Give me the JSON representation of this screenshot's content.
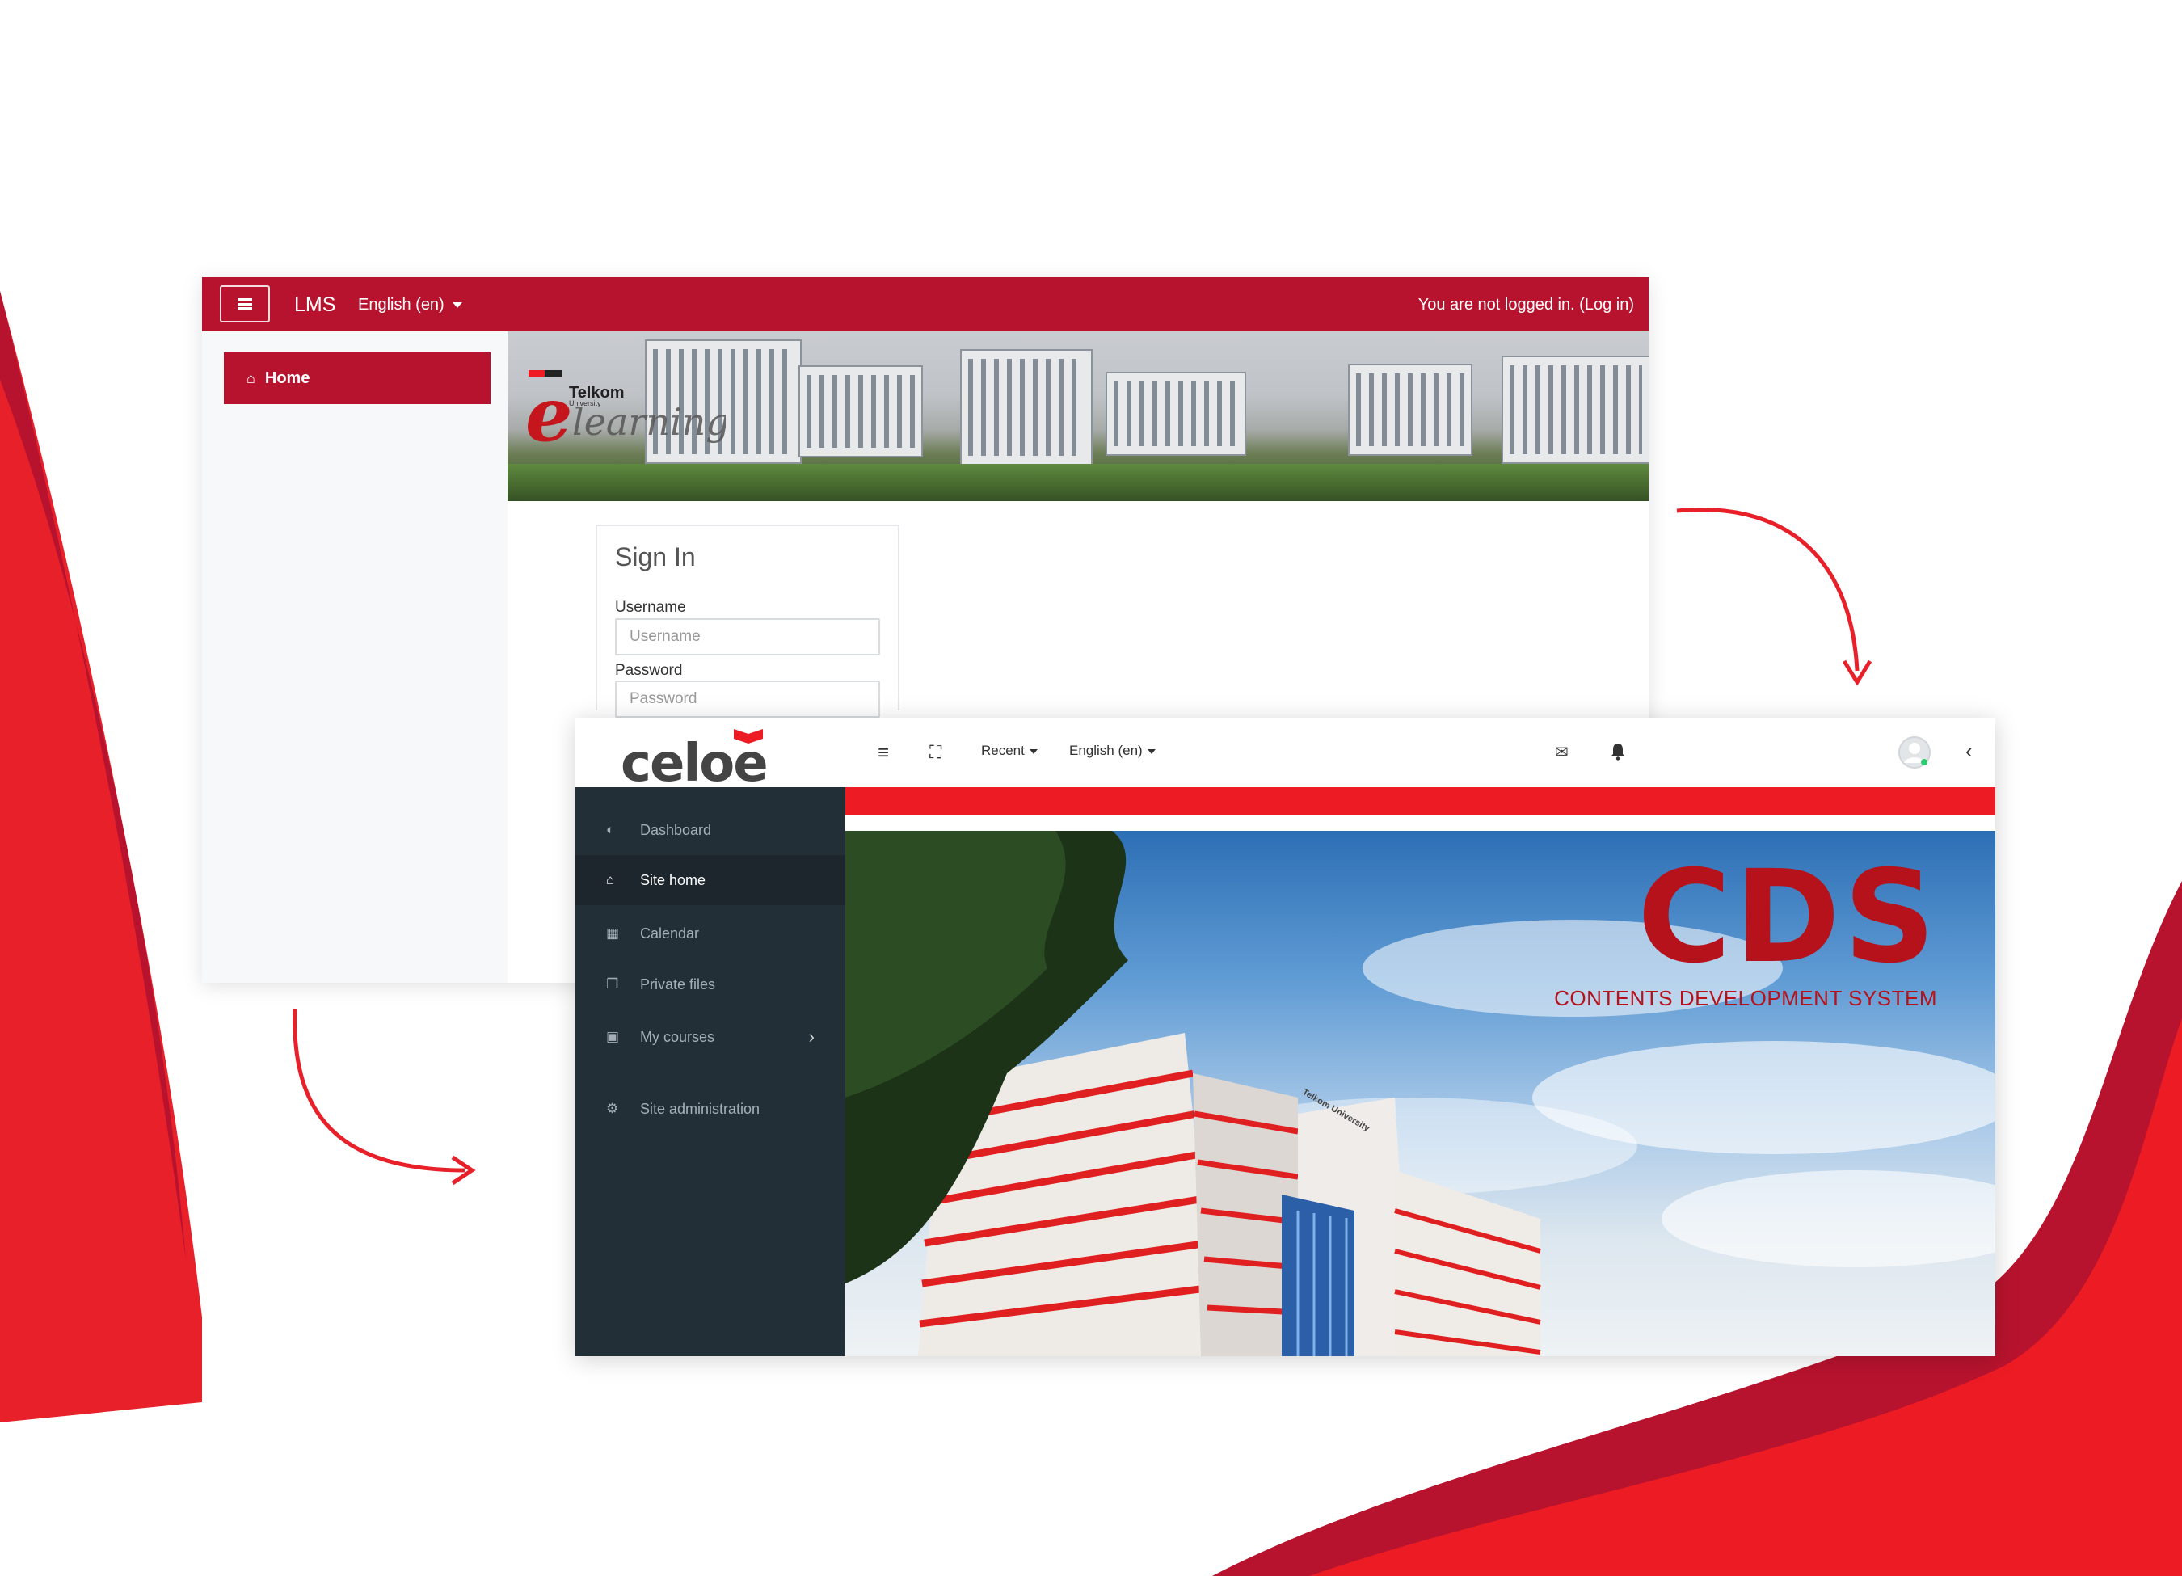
{
  "colors": {
    "lms_red": "#b8132e",
    "celoe_red": "#ed1c24",
    "sidebar_dark": "#232f36",
    "cds_red": "#b5121b"
  },
  "lms": {
    "brand": "LMS",
    "language": "English (en)",
    "login_status": "You are not logged in. (Log in)",
    "nav_home": "Home",
    "banner_logo_text": "Telkom University e-learning",
    "signin": {
      "title": "Sign In",
      "username_label": "Username",
      "username_placeholder": "Username",
      "password_label": "Password",
      "password_placeholder": "Password"
    }
  },
  "celoe": {
    "logo_text": "celoe",
    "header": {
      "recent": "Recent",
      "language": "English (en)"
    },
    "sidebar": [
      {
        "label": "Dashboard",
        "icon": "dashboard-icon"
      },
      {
        "label": "Site home",
        "icon": "home-icon"
      },
      {
        "label": "Calendar",
        "icon": "calendar-icon"
      },
      {
        "label": "Private files",
        "icon": "files-icon"
      },
      {
        "label": "My courses",
        "icon": "archive-icon"
      },
      {
        "label": "Site administration",
        "icon": "gear-icon"
      }
    ],
    "hero": {
      "title": "CDS",
      "subtitle": "CONTENTS DEVELOPMENT SYSTEM",
      "building_sign": "Telkom University"
    }
  }
}
